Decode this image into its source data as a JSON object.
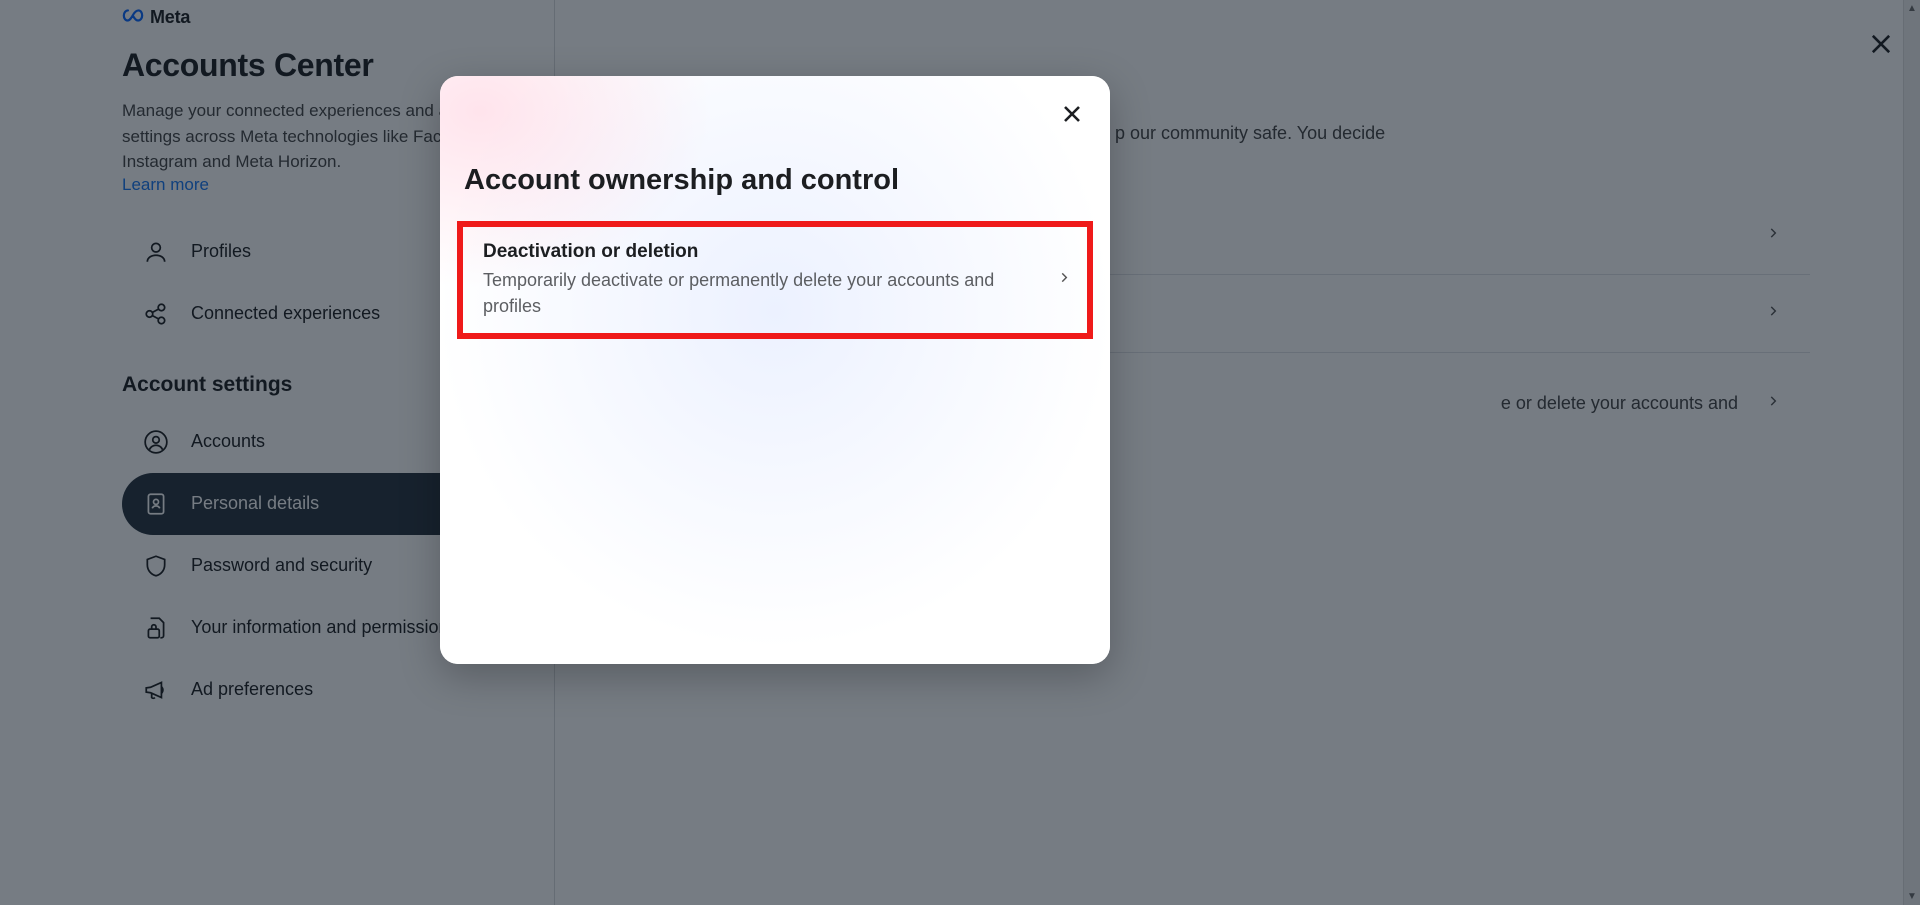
{
  "brand": {
    "name": "Meta"
  },
  "header": {
    "title": "Accounts Center",
    "description": "Manage your connected experiences and account settings across Meta technologies like Facebook, Instagram and Meta Horizon.",
    "learn_more": "Learn more"
  },
  "sidebar": {
    "section1": {
      "items": [
        {
          "label": "Profiles",
          "icon": "user-icon"
        },
        {
          "label": "Connected experiences",
          "icon": "share-icon"
        }
      ]
    },
    "section2_title": "Account settings",
    "section2": {
      "items": [
        {
          "label": "Accounts",
          "icon": "account-circle-icon"
        },
        {
          "label": "Personal details",
          "icon": "id-card-icon",
          "active": true
        },
        {
          "label": "Password and security",
          "icon": "shield-icon"
        },
        {
          "label": "Your information and permissions",
          "icon": "file-lock-icon"
        },
        {
          "label": "Ad preferences",
          "icon": "megaphone-icon"
        }
      ]
    }
  },
  "main": {
    "desc_fragment1": "p our community safe. You decide",
    "desc_fragment2": "e or delete your accounts and"
  },
  "modal": {
    "title": "Account ownership and control",
    "option": {
      "title": "Deactivation or deletion",
      "desc": "Temporarily deactivate or permanently delete your accounts and profiles"
    }
  }
}
